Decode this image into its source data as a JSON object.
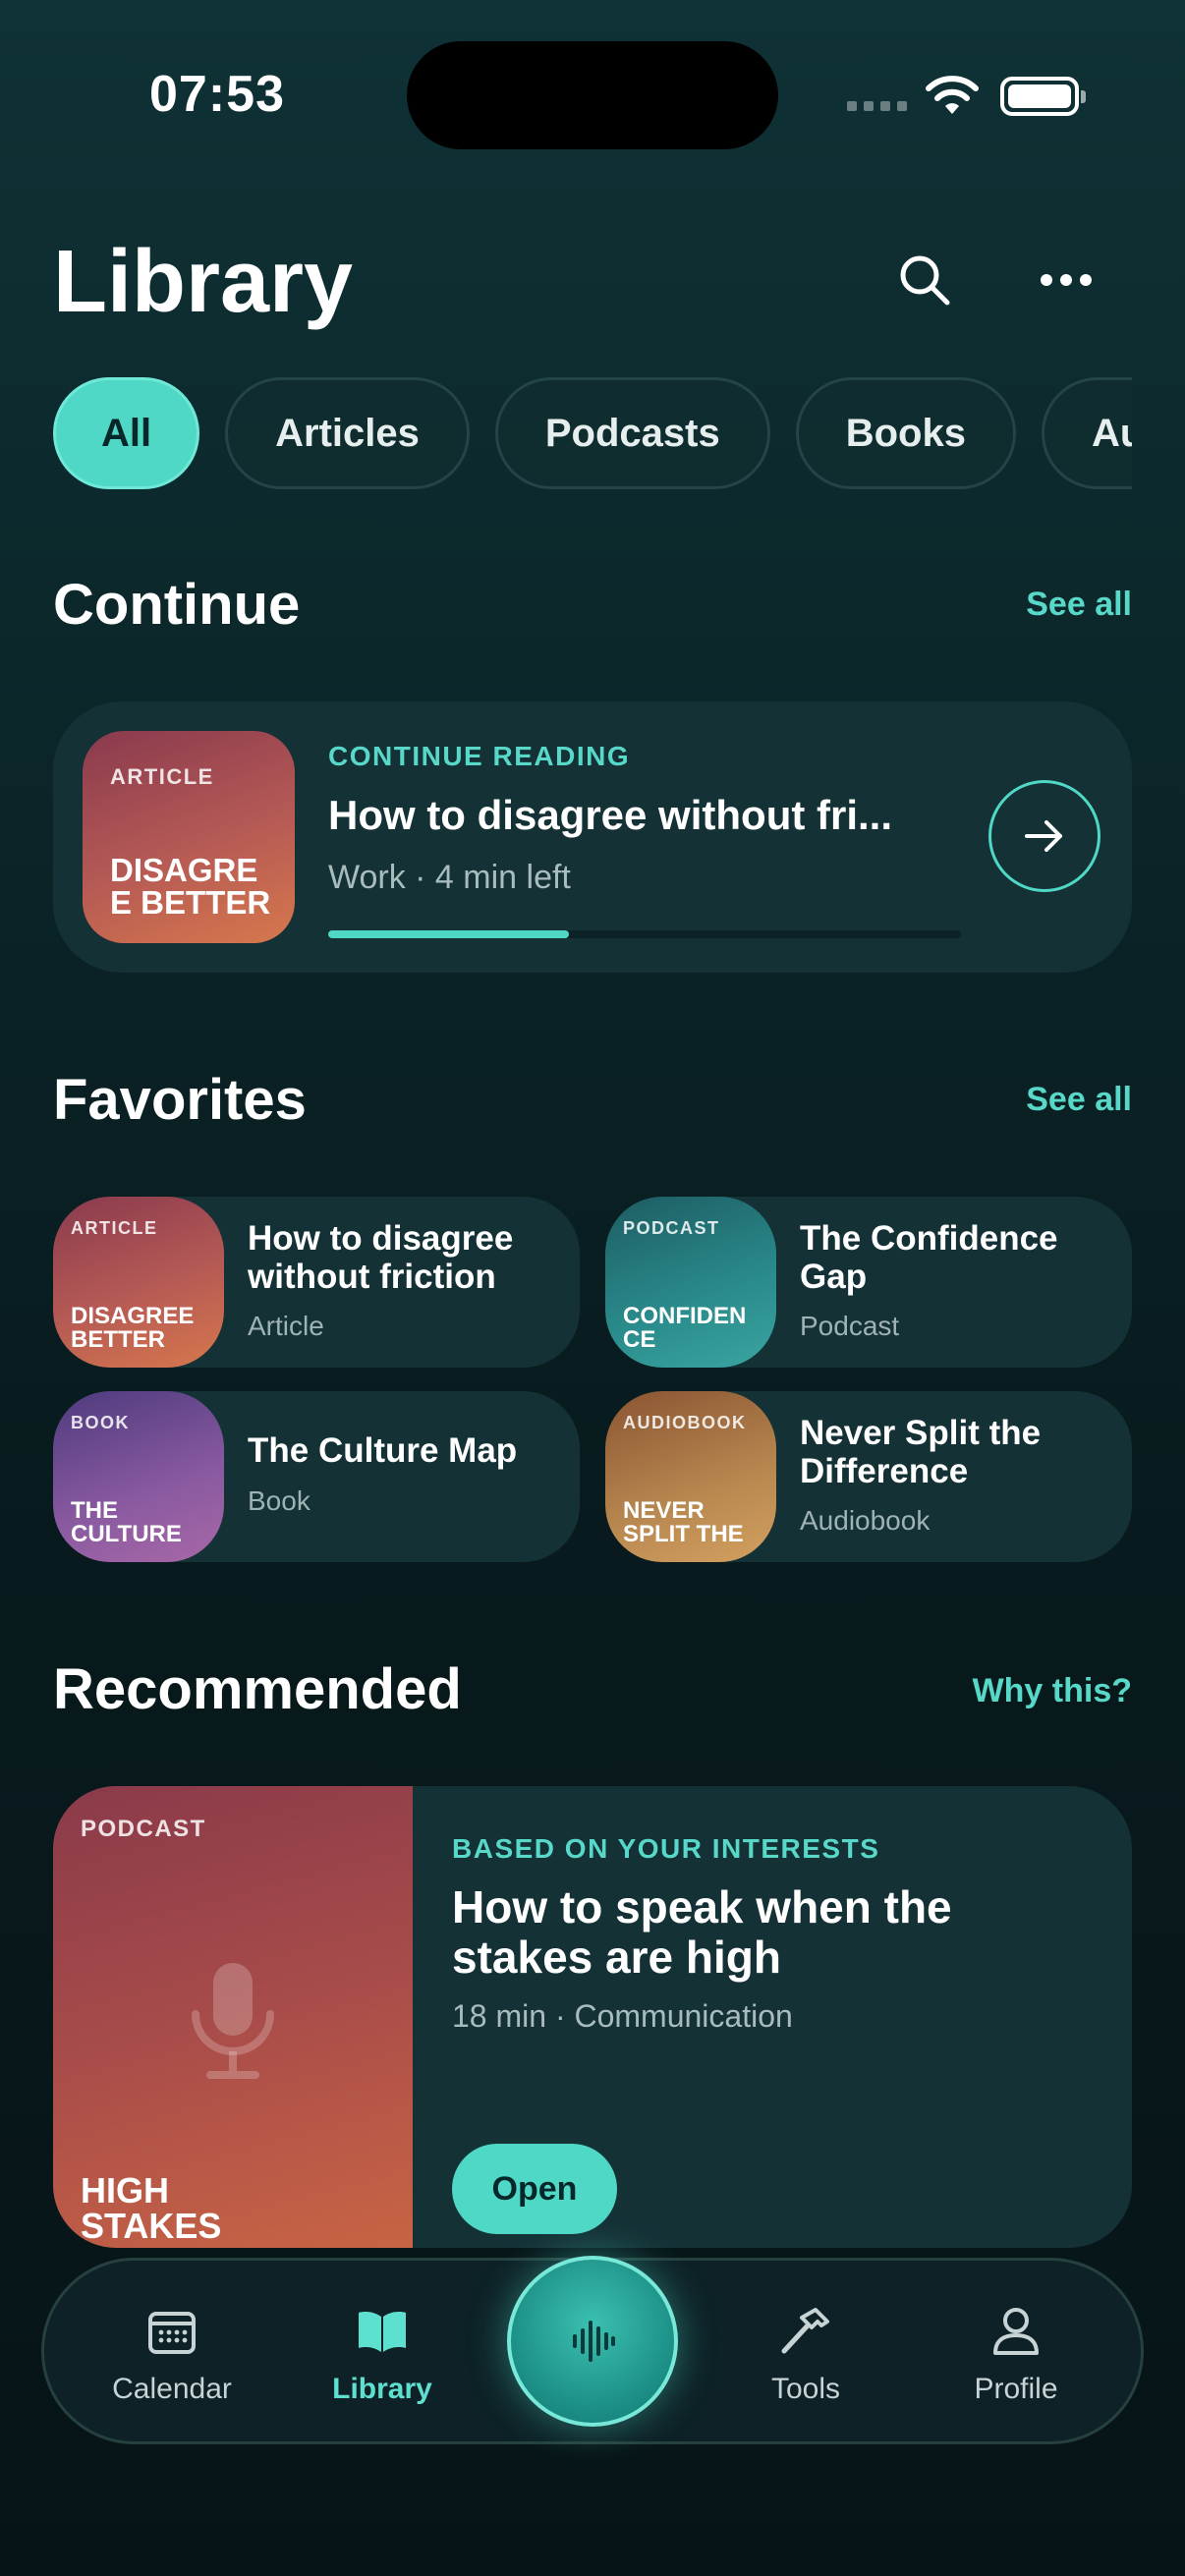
{
  "status": {
    "time": "07:53"
  },
  "header": {
    "title": "Library"
  },
  "filters": [
    "All",
    "Articles",
    "Podcasts",
    "Books",
    "Audiobooks"
  ],
  "continue": {
    "title": "Continue",
    "see_all": "See all",
    "card": {
      "cover_type": "ARTICLE",
      "cover_title": "DISAGRE E BETTER",
      "label": "CONTINUE READING",
      "title": "How to disagree without fri...",
      "meta": "Work · 4 min left",
      "progress": 0.38
    }
  },
  "favorites": {
    "title": "Favorites",
    "see_all": "See all",
    "items": [
      {
        "cover_type": "ARTICLE",
        "cover_title": "DISAGREE BETTER",
        "title": "How to disagree without friction",
        "sub": "Article"
      },
      {
        "cover_type": "PODCAST",
        "cover_title": "CONFIDEN CE",
        "title": "The Confidence Gap",
        "sub": "Podcast"
      },
      {
        "cover_type": "BOOK",
        "cover_title": "THE CULTURE",
        "title": "The Culture Map",
        "sub": "Book"
      },
      {
        "cover_type": "AUDIOBOOK",
        "cover_title": "NEVER SPLIT THE",
        "title": "Never Split the Difference",
        "sub": "Audiobook"
      }
    ]
  },
  "recommended": {
    "title": "Recommended",
    "why": "Why this?",
    "card": {
      "cover_type": "PODCAST",
      "cover_title": "HIGH STAKES",
      "label": "BASED ON YOUR INTERESTS",
      "title": "How to speak when the stakes are high",
      "meta": "18 min · Communication",
      "button": "Open"
    }
  },
  "tabbar": {
    "calendar": "Calendar",
    "library": "Library",
    "tools": "Tools",
    "profile": "Profile"
  },
  "colors": {
    "accent": "#4fd8c6",
    "background": "#0b2528",
    "card": "#143136"
  }
}
